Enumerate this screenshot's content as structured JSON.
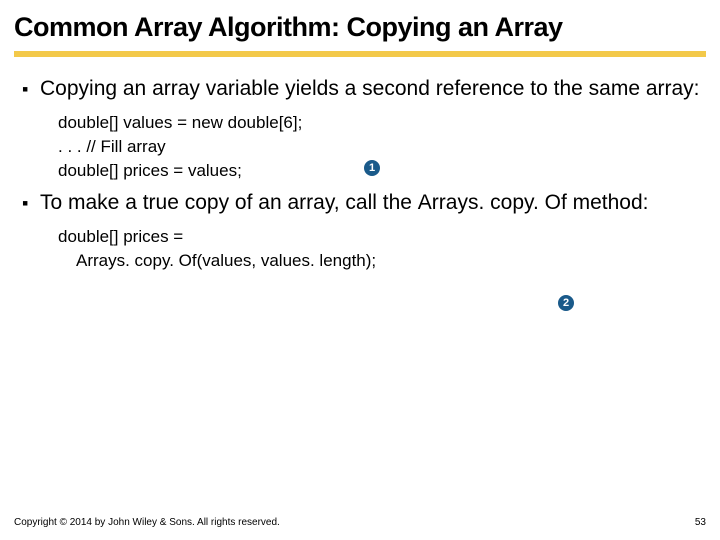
{
  "title": "Common Array Algorithm:  Copying an Array",
  "bullets": [
    {
      "text_pre": "Copying an array variable yields a second reference to the same array:"
    },
    {
      "text_pre": "To make a true copy of an array, call the ",
      "inline_code": "Arrays. copy. Of",
      "text_post": " method:"
    }
  ],
  "code_block_1": {
    "l1": "double[] values = new double[6];",
    "l2": ". . . // Fill array",
    "l3": "double[] prices = values;"
  },
  "code_block_2": {
    "l1": "double[] prices =",
    "l2": "Arrays. copy. Of(values, values. length);"
  },
  "badges": {
    "b1": "1",
    "b2": "2"
  },
  "footer": {
    "copyright": "Copyright © 2014 by John Wiley & Sons. All rights reserved.",
    "page": "53"
  }
}
